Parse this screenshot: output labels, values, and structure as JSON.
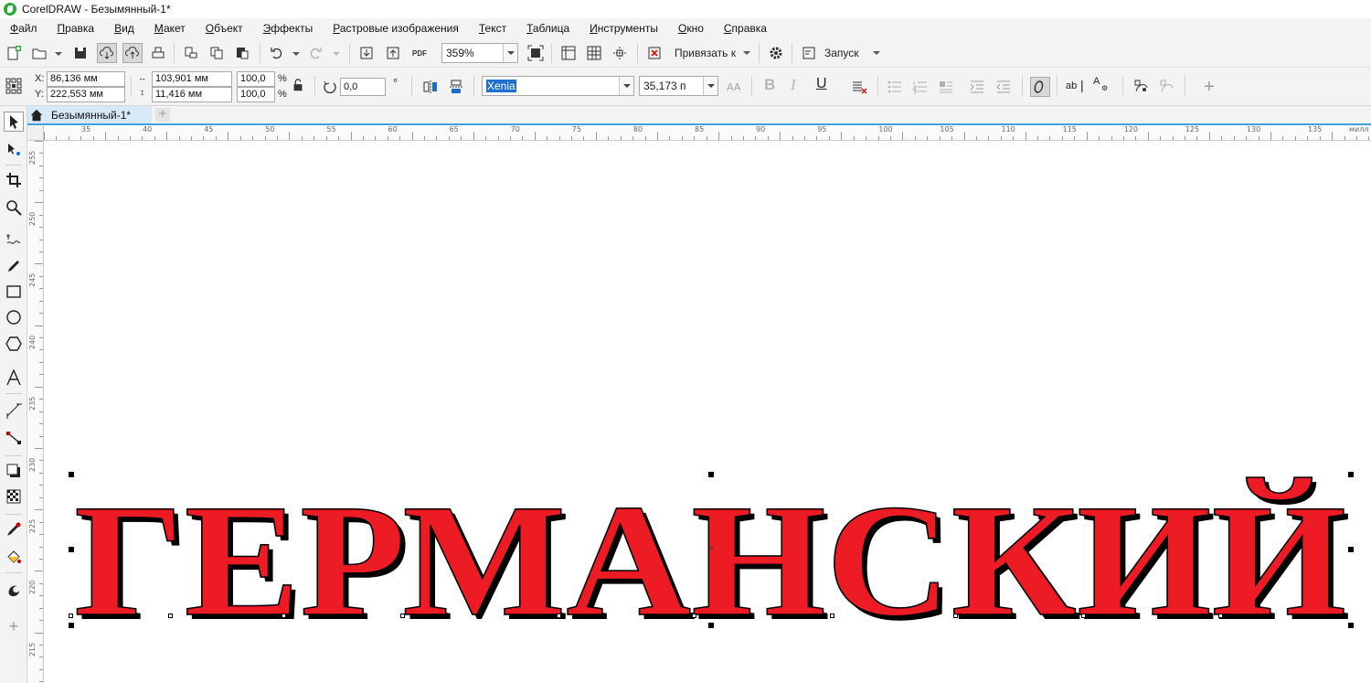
{
  "window": {
    "title": "CorelDRAW - Безымянный-1*"
  },
  "menu": [
    {
      "label": "Файл",
      "key": "Ф",
      "rest": "айл"
    },
    {
      "label": "Правка",
      "key": "П",
      "rest": "равка"
    },
    {
      "label": "Вид",
      "key": "В",
      "rest": "ид"
    },
    {
      "label": "Макет",
      "key": "М",
      "rest": "акет"
    },
    {
      "label": "Объект",
      "key": "О",
      "rest": "бъект"
    },
    {
      "label": "Эффекты",
      "key": "Э",
      "rest": "ффекты"
    },
    {
      "label": "Растровые изображения",
      "key": "Р",
      "rest": "астровые изображения"
    },
    {
      "label": "Текст",
      "key": "Т",
      "rest": "екст"
    },
    {
      "label": "Таблица",
      "key": "Т",
      "rest": "аблица"
    },
    {
      "label": "Инструменты",
      "key": "И",
      "rest": "нструменты"
    },
    {
      "label": "Окно",
      "key": "О",
      "rest": "кно"
    },
    {
      "label": "Справка",
      "key": "С",
      "rest": "правка"
    }
  ],
  "standard_toolbar": {
    "zoom_value": "359%",
    "snap_label": "Привязать к",
    "launch_label": "Запуск",
    "pdf_label": "PDF"
  },
  "property_bar": {
    "x_label": "X:",
    "y_label": "Y:",
    "x_value": "86,136 мм",
    "y_value": "222,553 мм",
    "width_value": "103,901 мм",
    "height_value": "11,416 мм",
    "scale_x": "100,0",
    "scale_y": "100,0",
    "percent": "%",
    "rotation_value": "0,0",
    "degree_symbol": "°",
    "font_name": "Xenia",
    "font_size": "35,173 п",
    "bold_label": "B",
    "italic_label": "I",
    "underline_label": "U",
    "text_label_ab": "ab",
    "text_label_A": "A"
  },
  "document_tab": {
    "label": "Безымянный-1*",
    "add_label": "+"
  },
  "ruler": {
    "horizontal_labels": [
      "35",
      "40",
      "45",
      "50",
      "55",
      "60",
      "65",
      "70",
      "75",
      "80",
      "85",
      "90",
      "95",
      "100",
      "105",
      "110",
      "115",
      "120",
      "125",
      "130",
      "135",
      "милл"
    ],
    "vertical_labels": [
      "255",
      "250",
      "245",
      "240",
      "235",
      "230",
      "225",
      "220",
      "215"
    ]
  },
  "artwork": {
    "text": "ГЕРМАНСКИЙ",
    "fill_color": "#ED1C24",
    "outline_color": "#000000",
    "shadow_color": "#000000"
  },
  "toolbox": {
    "add_label": "+"
  }
}
